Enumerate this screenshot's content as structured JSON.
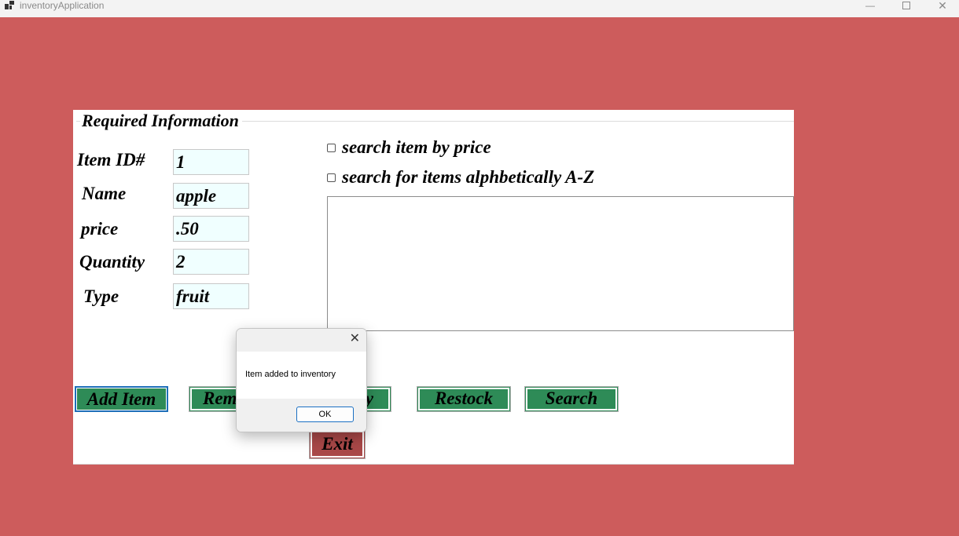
{
  "window": {
    "title": "inventoryApplication",
    "minimize": "—",
    "close": "✕"
  },
  "group": {
    "title": "Required Information"
  },
  "fields": {
    "item_id": {
      "label": "Item ID#",
      "value": "1"
    },
    "name": {
      "label": "Name",
      "value": "apple"
    },
    "price": {
      "label": "price",
      "value": ".50"
    },
    "quantity": {
      "label": "Quantity",
      "value": "2"
    },
    "type": {
      "label": "Type",
      "value": "fruit"
    }
  },
  "search": {
    "by_price": "search item by price",
    "alphabetical": "search for items alphbetically A-Z"
  },
  "buttons": {
    "add_item": "Add Item",
    "remove": "Rem",
    "display_tail": "y",
    "restock": "Restock",
    "search": "Search",
    "exit": "Exit"
  },
  "dialog": {
    "message": "Item added to inventory",
    "ok": "OK",
    "close": "✕"
  },
  "colors": {
    "background": "#cd5c5c",
    "button_green": "#2e8b57",
    "exit_red": "#a94848",
    "textbox_bg": "#f0ffff"
  }
}
